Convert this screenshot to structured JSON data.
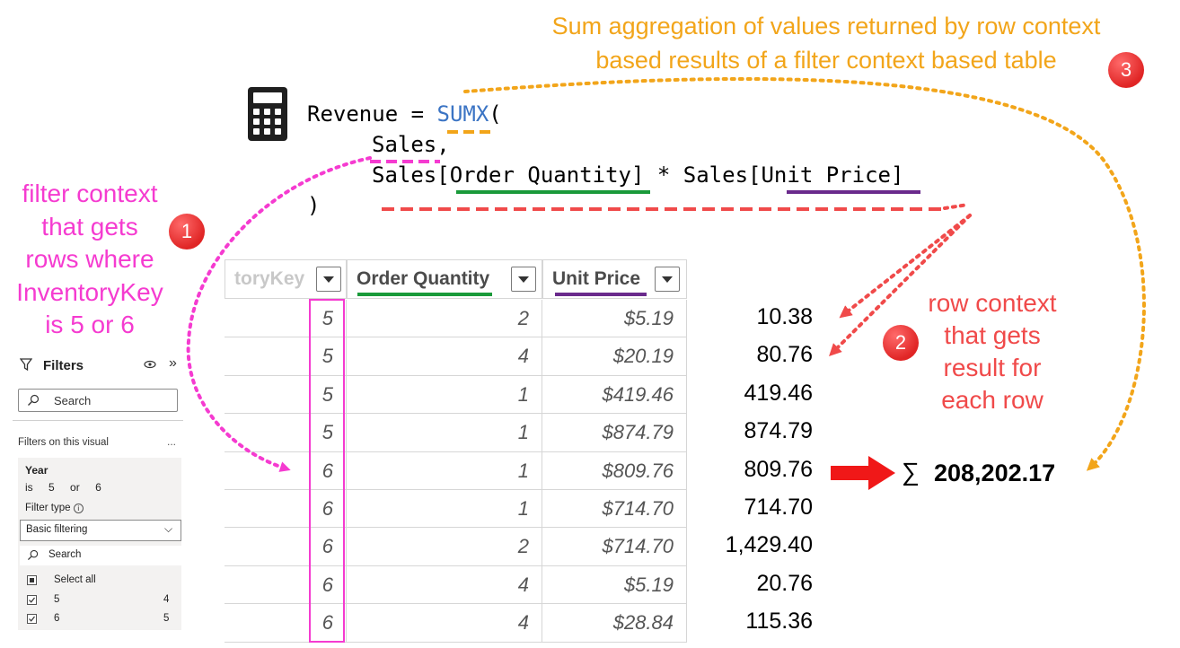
{
  "annotations": {
    "top_line1": "Sum aggregation of values returned by row context",
    "top_line2": "based results of a filter context based table",
    "left_lines": [
      "filter context",
      "that gets",
      "rows where",
      "InventoryKey",
      "is 5 or 6"
    ],
    "right_lines": [
      "row context",
      "that gets",
      "result for",
      "each row"
    ],
    "badge1": "1",
    "badge2": "2",
    "badge3": "3"
  },
  "code": {
    "line1_prefix": "Revenue = ",
    "line1_func": "SUMX",
    "line1_suffix": "(",
    "line2": "Sales,",
    "line3": "Sales[Order Quantity] * Sales[Unit Price]",
    "line4": ")"
  },
  "table": {
    "columns": [
      "toryKey",
      "Order Quantity",
      "Unit Price"
    ],
    "rows": [
      {
        "key": "5",
        "qty": "2",
        "price": "$5.19",
        "result": "10.38"
      },
      {
        "key": "5",
        "qty": "4",
        "price": "$20.19",
        "result": "80.76"
      },
      {
        "key": "5",
        "qty": "1",
        "price": "$419.46",
        "result": "419.46"
      },
      {
        "key": "5",
        "qty": "1",
        "price": "$874.79",
        "result": "874.79"
      },
      {
        "key": "6",
        "qty": "1",
        "price": "$809.76",
        "result": "809.76"
      },
      {
        "key": "6",
        "qty": "1",
        "price": "$714.70",
        "result": "714.70"
      },
      {
        "key": "6",
        "qty": "2",
        "price": "$714.70",
        "result": "1,429.40"
      },
      {
        "key": "6",
        "qty": "4",
        "price": "$5.19",
        "result": "20.76"
      },
      {
        "key": "6",
        "qty": "4",
        "price": "$28.84",
        "result": "115.36"
      }
    ]
  },
  "total": {
    "symbol": "∑",
    "value": "208,202.17"
  },
  "filters_pane": {
    "title": "Filters",
    "search_placeholder": "Search",
    "section_label": "Filters on this visual",
    "more": "...",
    "field_name": "Year",
    "condition_is": "is",
    "condition_v1": "5",
    "condition_or": "or",
    "condition_v2": "6",
    "filter_type_label": "Filter type",
    "filter_type_value": "Basic filtering",
    "inner_search_placeholder": "Search",
    "select_all": "Select all",
    "items": [
      {
        "label": "5",
        "count": "4"
      },
      {
        "label": "6",
        "count": "5"
      }
    ]
  },
  "colors": {
    "filter_context": "#f53bd0",
    "row_context": "#f04a4a",
    "aggregation": "#f2a51a",
    "quantity_underline": "#1a9a3a",
    "price_underline": "#6a2a8c",
    "function_blue": "#3b74c4"
  }
}
